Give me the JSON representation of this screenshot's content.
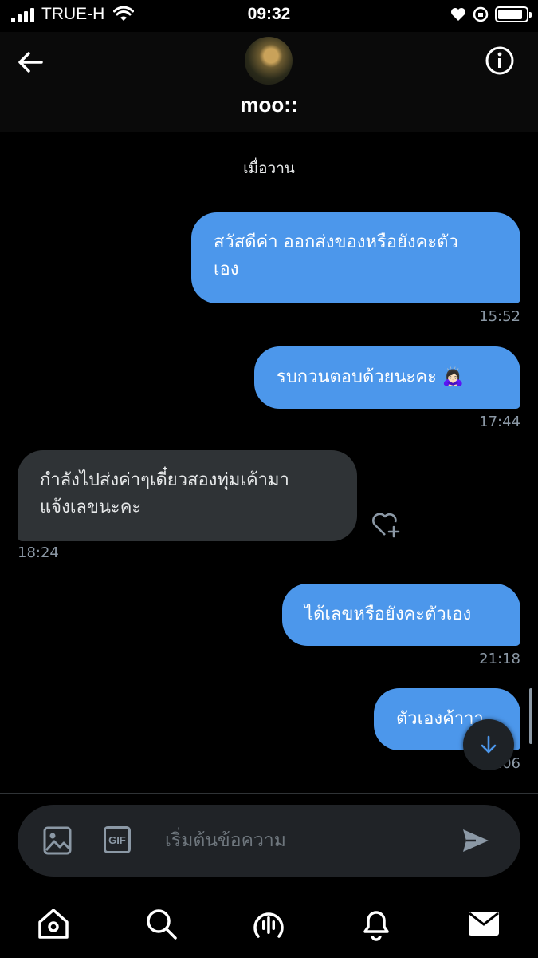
{
  "status_bar": {
    "carrier": "TRUE-H",
    "time": "09:32",
    "battery_level": 0.88,
    "icons": [
      "signal-icon",
      "wifi-icon",
      "heart-icon",
      "orientation-lock-icon",
      "battery-icon"
    ]
  },
  "header": {
    "username": "moo::",
    "icons": [
      "back-arrow-icon",
      "avatar",
      "info-icon"
    ]
  },
  "chat": {
    "day_label": "เมื่อวาน",
    "messages": [
      {
        "direction": "out",
        "text": "สวัสดีค่า ออกส่งของหรือยังคะตัว\nเอง",
        "time": "15:52"
      },
      {
        "direction": "out",
        "text": "รบกวนตอบด้วยนะคะ 🙇🏻‍♀️",
        "time": "17:44"
      },
      {
        "direction": "in",
        "text": "กำลังไปส่งค่าๆเดี๋ยวสองทุ่มเค้ามา\nแจ้งเลขนะคะ",
        "time": "18:24"
      },
      {
        "direction": "out",
        "text": "ได้เลขหรือยังคะตัวเอง",
        "time": "21:18"
      },
      {
        "direction": "out",
        "text": "ตัวเองค้าาา",
        "time": "21:06"
      }
    ],
    "colors": {
      "outgoing": "#4c97eb",
      "incoming": "#2f3336"
    }
  },
  "composer": {
    "placeholder": "เริ่มต้นข้อความ",
    "gif_label": "GIF"
  },
  "nav": {
    "items": [
      "home-icon",
      "search-icon",
      "spaces-icon",
      "notifications-icon",
      "messages-icon"
    ]
  }
}
